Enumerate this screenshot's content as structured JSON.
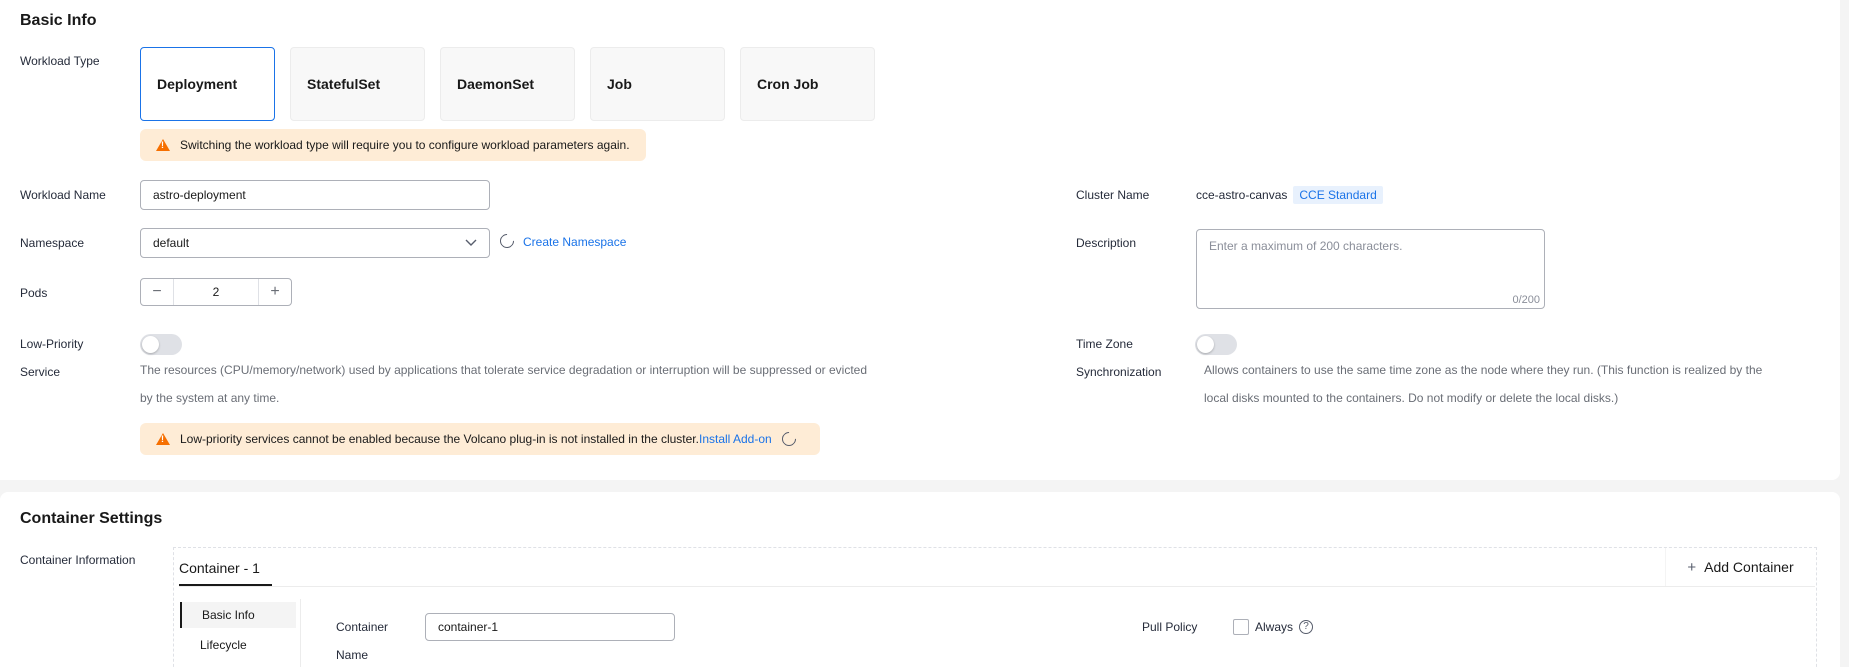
{
  "basic": {
    "title": "Basic Info",
    "workload_type_label": "Workload Type",
    "workload_types": [
      "Deployment",
      "StatefulSet",
      "DaemonSet",
      "Job",
      "Cron Job"
    ],
    "switch_warning": "Switching the workload type will require you to configure workload parameters again.",
    "workload_name_label": "Workload Name",
    "workload_name_value": "astro-deployment",
    "namespace_label": "Namespace",
    "namespace_value": "default",
    "create_namespace": "Create Namespace",
    "pods_label": "Pods",
    "pods_value": "2",
    "low_priority_label_1": "Low-Priority",
    "low_priority_label_2": "Service",
    "low_priority_help_1": "The resources (CPU/memory/network) used by applications that tolerate service degradation or interruption will be suppressed or evicted",
    "low_priority_help_2": "by the system at any time.",
    "low_priority_warning": "Low-priority services cannot be enabled because the Volcano plug-in is not installed in the cluster.",
    "install_addon": "Install Add-on",
    "cluster_name_label": "Cluster Name",
    "cluster_name_value": "cce-astro-canvas",
    "cluster_badge": "CCE Standard",
    "description_label": "Description",
    "description_placeholder": "Enter a maximum of 200 characters.",
    "description_counter": "0/200",
    "timezone_label_1": "Time Zone",
    "timezone_label_2": "Synchronization",
    "timezone_help_1": "Allows containers to use the same time zone as the node where they run. (This function is realized by the",
    "timezone_help_2": "local disks mounted to the containers. Do not modify or delete the local disks.)"
  },
  "container": {
    "title": "Container Settings",
    "info_label": "Container Information",
    "tab_label": "Container - 1",
    "add_container": "Add Container",
    "side_items": [
      "Basic Info",
      "Lifecycle"
    ],
    "container_name_label_1": "Container",
    "container_name_label_2": "Name",
    "container_name_value": "container-1",
    "pull_policy_label": "Pull Policy",
    "pull_policy_option": "Always"
  },
  "colors": {
    "accent": "#1a73e8",
    "warning_bg": "#feecd6",
    "warning_icon": "#f66f00"
  }
}
